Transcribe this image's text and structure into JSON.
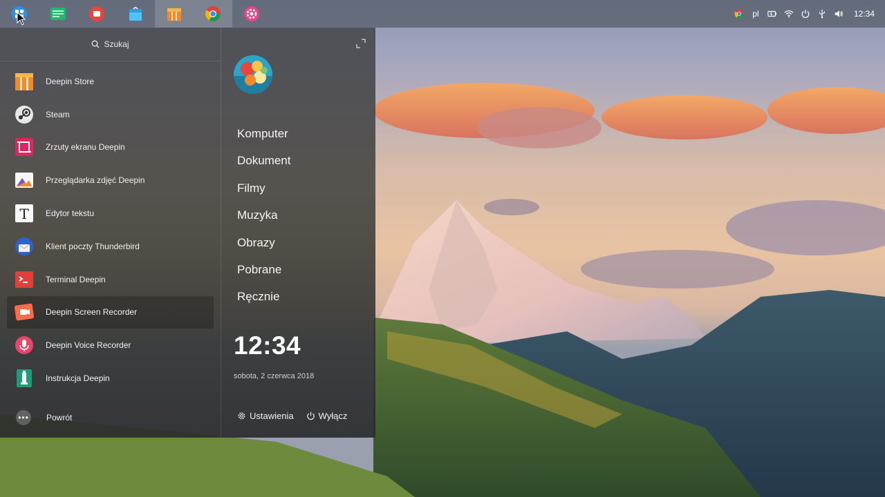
{
  "dock": {
    "apps": [
      {
        "icon": "launcher-icon",
        "active": false
      },
      {
        "icon": "file-manager-icon",
        "active": false
      },
      {
        "icon": "screen-recorder-icon",
        "active": false
      },
      {
        "icon": "app-store-bag-icon",
        "active": false
      },
      {
        "icon": "deepin-store-icon",
        "active": true
      },
      {
        "icon": "chrome-icon",
        "active": true
      },
      {
        "icon": "settings-icon",
        "active": false
      }
    ],
    "tray": {
      "language": "pl",
      "clock": "12:34"
    }
  },
  "launcher": {
    "search_label": "Szukaj",
    "apps": [
      {
        "label": "Deepin Store",
        "icon": "deepin-store-icon"
      },
      {
        "label": "Steam",
        "icon": "steam-icon"
      },
      {
        "label": "Zrzuty ekranu Deepin",
        "icon": "screenshot-icon"
      },
      {
        "label": "Przeglądarka zdjęć Deepin",
        "icon": "image-viewer-icon"
      },
      {
        "label": "Edytor tekstu",
        "icon": "text-editor-icon"
      },
      {
        "label": "Klient poczty Thunderbird",
        "icon": "thunderbird-icon"
      },
      {
        "label": "Terminal Deepin",
        "icon": "terminal-icon"
      },
      {
        "label": "Deepin Screen Recorder",
        "icon": "screen-recorder-icon"
      },
      {
        "label": "Deepin Voice Recorder",
        "icon": "voice-recorder-icon"
      },
      {
        "label": "Instrukcja Deepin",
        "icon": "manual-icon"
      }
    ],
    "back_label": "Powrót",
    "places": [
      "Komputer",
      "Dokument",
      "Filmy",
      "Muzyka",
      "Obrazy",
      "Pobrane",
      "Ręcznie"
    ],
    "clock": "12:34",
    "date": "sobota, 2 czerwca 2018",
    "settings_label": "Ustawienia",
    "shutdown_label": "Wyłącz"
  },
  "colors": {
    "accent_red": "#e8453c",
    "accent_orange": "#f08a2a",
    "accent_blue": "#2f8fe0"
  }
}
